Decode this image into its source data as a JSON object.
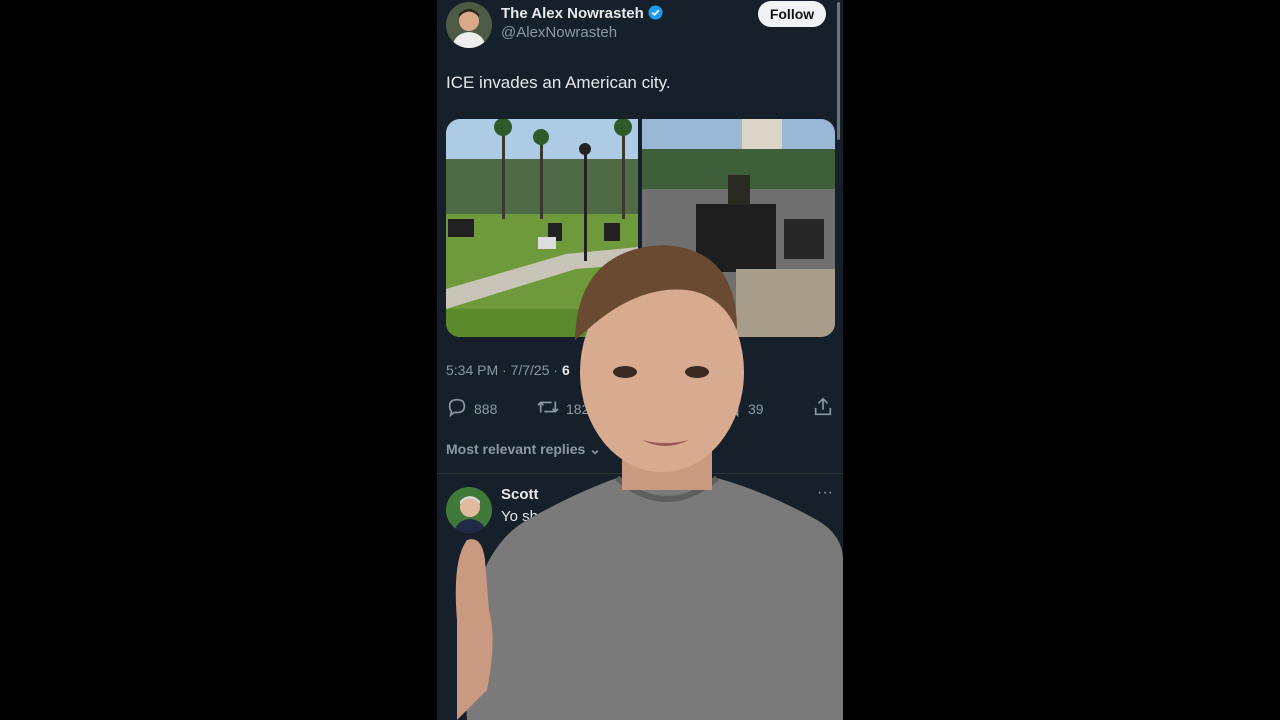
{
  "tweet": {
    "display_name": "The Alex Nowrasteh",
    "handle": "@AlexNowrasteh",
    "follow_label": "Follow",
    "text": "ICE invades an American city.",
    "timestamp": "5:34 PM · 7/7/25 · ",
    "views_partial": "6",
    "reply_count": "888",
    "retweet_count": "182",
    "bookmark_count": "39"
  },
  "replies": {
    "sort_label": "Most relevant replies",
    "first": {
      "name_partial": "Scott",
      "text_partial": "Yo sh"
    }
  },
  "icons": {
    "verified": "verified-badge-icon",
    "reply": "reply-icon",
    "retweet": "retweet-icon",
    "bookmark": "bookmark-icon",
    "share": "share-icon",
    "more": "more-icon"
  },
  "colors": {
    "background": "#15202b",
    "text": "#e7e9ea",
    "muted": "#8b98a5",
    "verified": "#1d9bf0",
    "follow_button": "#eff3f4"
  }
}
